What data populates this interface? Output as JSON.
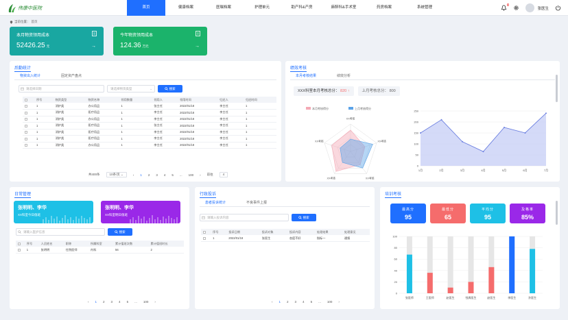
{
  "nav": {
    "items": [
      "首页",
      "健康档案",
      "医嘱档案",
      "护理单元",
      "助产科&产房",
      "麻醉科&手术室",
      "药房档案",
      "系统管理"
    ],
    "active": 0,
    "badge": "6",
    "user": "张医生"
  },
  "breadcrumb": {
    "label": "当前位置：",
    "current": "首页"
  },
  "stats": [
    {
      "title": "本月物资领用成本",
      "value": "52426.25",
      "unit": "元",
      "color": "#19a7a1"
    },
    {
      "title": "今年物资领用成本",
      "value": "124.36",
      "unit": "万元",
      "color": "#1bb36b"
    }
  ],
  "material": {
    "title": "后勤统计",
    "tabs": [
      "物资出入统计",
      "固定资产盘点"
    ],
    "date_placeholder": "请选择日期",
    "type_placeholder": "请选择物资类型",
    "search": "搜索",
    "columns": [
      "",
      "序号",
      "物资类型",
      "物资名称",
      "领用数量",
      "领用人",
      "领用时间",
      "归还人",
      "归还时间"
    ],
    "rows": [
      [
        "1",
        "消护类",
        "办公用品",
        "1",
        "张主任",
        "2022/01/18",
        "李主任",
        "1"
      ],
      [
        "1",
        "消护类",
        "医疗用品",
        "1",
        "李主任",
        "2022/01/18",
        "李主任",
        "1"
      ],
      [
        "1",
        "消护类",
        "办公用品",
        "1",
        "李主任",
        "2022/01/18",
        "李主任",
        "1"
      ],
      [
        "1",
        "消护类",
        "医疗用品",
        "1",
        "张主任",
        "2022/01/18",
        "李主任",
        "1"
      ],
      [
        "1",
        "消护类",
        "医疗用品",
        "1",
        "李主任",
        "2022/01/18",
        "李主任",
        "1"
      ],
      [
        "1",
        "消护类",
        "医疗用品",
        "1",
        "李主任",
        "2022/01/18",
        "李主任",
        "1"
      ],
      [
        "1",
        "消护类",
        "办公用品",
        "1",
        "李主任",
        "2022/01/18",
        "李主任",
        "1"
      ]
    ],
    "pager": {
      "total": "共400条",
      "size": "10条/页",
      "pages": [
        "1",
        "2",
        "3",
        "4",
        "5",
        "...",
        "100"
      ],
      "goto": "前往",
      "goto_value": "4"
    }
  },
  "performance": {
    "title": "绩效考核",
    "tabs": [
      "本月考核结果",
      "绩效分析"
    ],
    "score_label": "XXX科室本月考核总分：",
    "score": "820",
    "score_arrow": "↑",
    "last_label": "上月考核总分：",
    "last_score": "800",
    "legend": [
      "本月考核得分",
      "上月考核得分"
    ]
  },
  "duty": {
    "title": "日常管理",
    "cards": [
      {
        "names": "张明明、李华",
        "sub": "XX科室今日值班",
        "color": "#1ec0e6"
      },
      {
        "names": "张明明、李华",
        "sub": "XX科室明日值班",
        "color": "#9a28e8"
      }
    ],
    "search_placeholder": "请输入医护信息",
    "search": "搜索",
    "columns": [
      "",
      "序号",
      "人员姓名",
      "职称",
      "所属科室",
      "累计值班次数",
      "累计值班时长"
    ],
    "rows": [
      [
        "1",
        "张明明",
        "住院医师",
        "内科",
        "56",
        "2"
      ]
    ],
    "pager": [
      "1",
      "2",
      "3",
      "4",
      "5",
      "...",
      "100"
    ]
  },
  "admin": {
    "title": "行政投诉",
    "tabs": [
      "患者投诉统计",
      "不良事件上报"
    ],
    "search_placeholder": "请输入投诉内容",
    "search": "搜索",
    "columns": [
      "",
      "序号",
      "投诉日期",
      "投诉对象",
      "投诉内容",
      "处理结果",
      "处理意见"
    ],
    "rows": [
      [
        "1",
        "2022/01/18",
        "张医生",
        "态度不好",
        "指标一",
        "通报"
      ]
    ],
    "pager": [
      "1",
      "2",
      "3",
      "4",
      "5",
      "...",
      "100"
    ]
  },
  "training": {
    "title": "培训考核",
    "kpis": [
      {
        "label": "最高分",
        "value": "95",
        "color": "#1f6fff"
      },
      {
        "label": "最低分",
        "value": "65",
        "color": "#f56c6c"
      },
      {
        "label": "平均分",
        "value": "95",
        "color": "#1ec0e6"
      },
      {
        "label": "及格率",
        "value": "85%",
        "color": "#9a28e8"
      }
    ]
  },
  "chart_data": [
    {
      "type": "radar",
      "legend": [
        "本月考核得分",
        "上月考核得分"
      ],
      "axes": [
        "XX考核",
        "XX考核",
        "XX考核",
        "XX考核",
        "XX考核"
      ],
      "series": [
        {
          "name": "本月考核得分",
          "values": [
            78,
            55,
            60,
            90,
            72
          ],
          "color": "#f4a9b5"
        },
        {
          "name": "上月考核得分",
          "values": [
            45,
            85,
            75,
            50,
            40
          ],
          "color": "#5aa3e8"
        }
      ],
      "max": 100
    },
    {
      "type": "area",
      "categories": [
        "1月",
        "2月",
        "3月",
        "4月",
        "5月",
        "6月",
        "7月"
      ],
      "values": [
        150,
        210,
        110,
        65,
        175,
        150,
        240
      ],
      "ylim": [
        0,
        250
      ],
      "yticks": [
        0,
        50,
        100,
        150,
        200,
        250
      ],
      "color": "#6b7fe0"
    },
    {
      "type": "bar",
      "categories": [
        "张医师",
        "王医师",
        "赵医生",
        "钱周医生",
        "赵医生",
        "李医生",
        "孙医生"
      ],
      "values": [
        68,
        36,
        10,
        20,
        46,
        100,
        78
      ],
      "ylim": [
        0,
        100
      ],
      "yticks": [
        0,
        20,
        40,
        60,
        80,
        100
      ],
      "colors": [
        "#1ec0e6",
        "#f56c6c",
        "#f56c6c",
        "#f56c6c",
        "#f56c6c",
        "#1f6fff",
        "#1ec0e6"
      ],
      "bg": "#e6e6e6"
    }
  ]
}
